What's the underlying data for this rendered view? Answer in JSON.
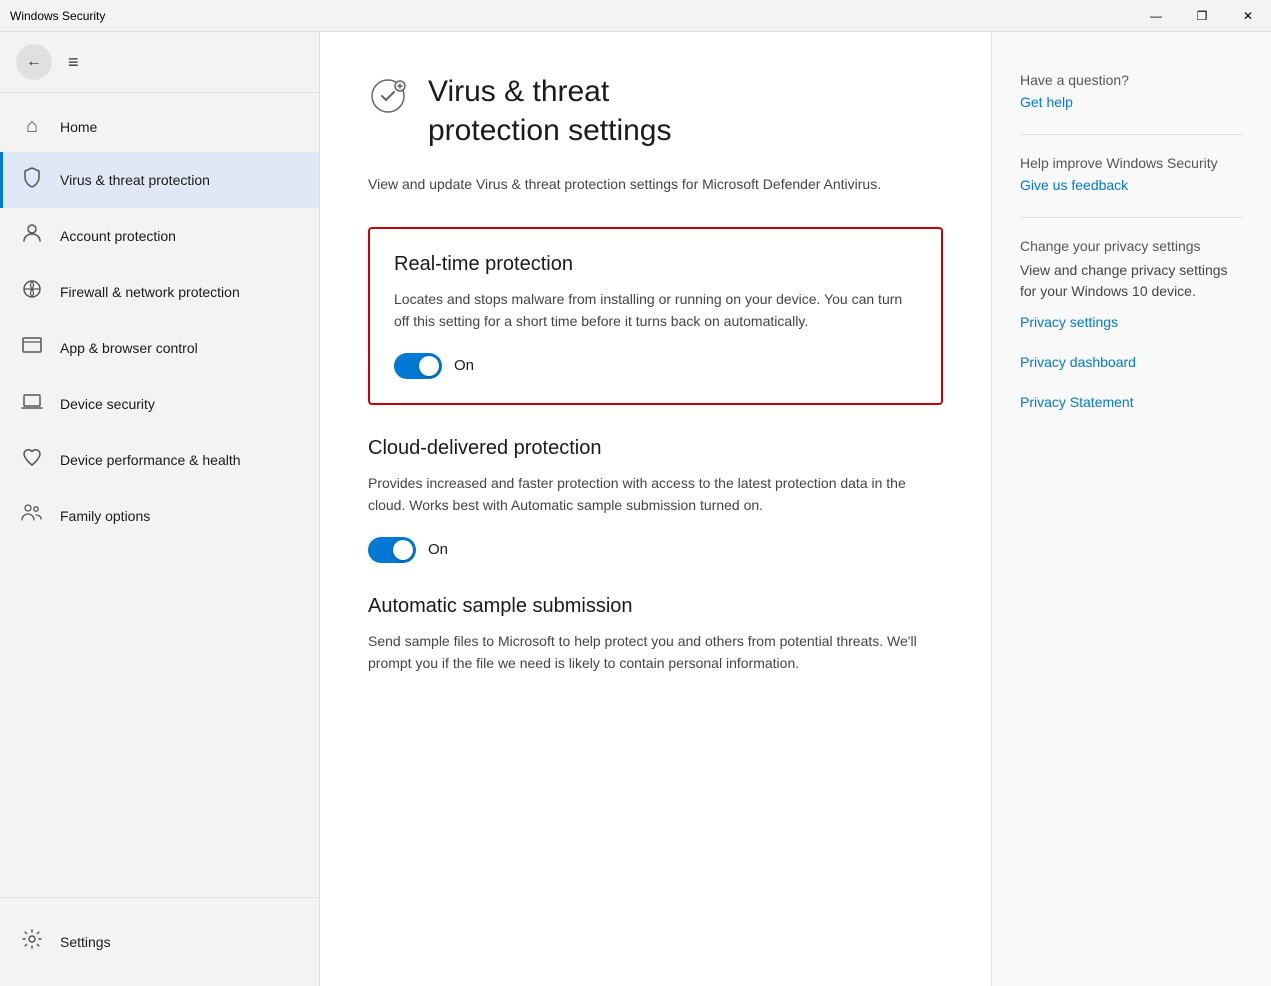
{
  "titlebar": {
    "title": "Windows Security",
    "minimize": "—",
    "restore": "❐",
    "close": "✕"
  },
  "sidebar": {
    "hamburger": "≡",
    "back_icon": "←",
    "nav_items": [
      {
        "id": "home",
        "icon": "⌂",
        "label": "Home",
        "active": false
      },
      {
        "id": "virus",
        "icon": "🛡",
        "label": "Virus & threat protection",
        "active": true
      },
      {
        "id": "account",
        "icon": "👤",
        "label": "Account protection",
        "active": false
      },
      {
        "id": "firewall",
        "icon": "📶",
        "label": "Firewall & network protection",
        "active": false
      },
      {
        "id": "browser",
        "icon": "☐",
        "label": "App & browser control",
        "active": false
      },
      {
        "id": "device-security",
        "icon": "💻",
        "label": "Device security",
        "active": false
      },
      {
        "id": "device-health",
        "icon": "♡",
        "label": "Device performance & health",
        "active": false
      },
      {
        "id": "family",
        "icon": "👥",
        "label": "Family options",
        "active": false
      }
    ],
    "settings_label": "Settings"
  },
  "main": {
    "page_icon": "⚙",
    "page_title": "Virus & threat\nprotection settings",
    "page_subtitle": "View and update Virus & threat protection settings for Microsoft Defender Antivirus.",
    "sections": [
      {
        "id": "realtime",
        "title": "Real-time protection",
        "desc": "Locates and stops malware from installing or running on your device. You can turn off this setting for a short time before it turns back on automatically.",
        "toggle_state": true,
        "toggle_label": "On",
        "highlighted": true
      },
      {
        "id": "cloud",
        "title": "Cloud-delivered protection",
        "desc": "Provides increased and faster protection with access to the latest protection data in the cloud. Works best with Automatic sample submission turned on.",
        "toggle_state": true,
        "toggle_label": "On",
        "highlighted": false
      },
      {
        "id": "sample",
        "title": "Automatic sample submission",
        "desc": "Send sample files to Microsoft to help protect you and others from potential threats. We'll prompt you if the file we need is likely to contain personal information.",
        "toggle_state": null,
        "highlighted": false
      }
    ]
  },
  "right_panel": {
    "question": "Have a question?",
    "get_help": "Get help",
    "improve_title": "Help improve Windows Security",
    "feedback_link": "Give us feedback",
    "privacy_title": "Change your privacy settings",
    "privacy_desc": "View and change privacy settings for your Windows 10 device.",
    "privacy_settings_link": "Privacy settings",
    "privacy_dashboard_link": "Privacy dashboard",
    "privacy_statement_link": "Privacy Statement"
  }
}
